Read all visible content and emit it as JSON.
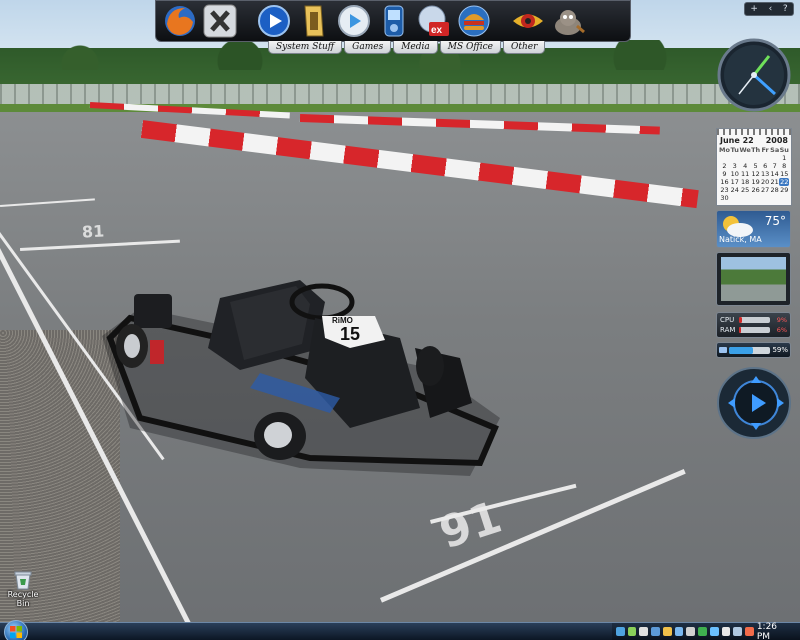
{
  "desktop": {
    "wallpaper_numbers": [
      "81",
      "91"
    ],
    "kart_number": "15",
    "kart_brand": "RiMO"
  },
  "dock": {
    "icons": [
      {
        "name": "firefox-icon"
      },
      {
        "name": "xion-icon"
      },
      {
        "name": "media-player-icon"
      },
      {
        "name": "winamp-icon"
      },
      {
        "name": "play-icon"
      },
      {
        "name": "mp3-player-icon"
      },
      {
        "name": "excel-icon"
      },
      {
        "name": "burger-icon"
      },
      {
        "name": "eye-icon"
      },
      {
        "name": "gimp-icon"
      }
    ],
    "tabs": [
      "System Stuff",
      "Games",
      "Media",
      "MS Office",
      "Other"
    ]
  },
  "sidebar": {
    "controls": [
      "+",
      "‹",
      "?"
    ],
    "calendar": {
      "month_day": "June 22",
      "year": "2008",
      "weekdays": [
        "Mo",
        "Tu",
        "We",
        "Th",
        "Fr",
        "Sa",
        "Su"
      ],
      "days": [
        "",
        "",
        "",
        "",
        "",
        "",
        "1",
        "2",
        "3",
        "4",
        "5",
        "6",
        "7",
        "8",
        "9",
        "10",
        "11",
        "12",
        "13",
        "14",
        "15",
        "16",
        "17",
        "18",
        "19",
        "20",
        "21",
        "22",
        "23",
        "24",
        "25",
        "26",
        "27",
        "28",
        "29",
        "30"
      ],
      "today": "22"
    },
    "weather": {
      "temp": "75°",
      "location": "Natick, MA"
    },
    "cpu": {
      "cpu_label": "CPU",
      "ram_label": "RAM",
      "cpu_value": "9%",
      "ram_value": "6%",
      "cpu_level": 0.09,
      "ram_level": 0.06
    },
    "battery": {
      "value": "59%",
      "level": 0.59
    }
  },
  "desktop_icons": {
    "recycle_bin": "Recycle Bin"
  },
  "taskbar": {
    "time": "1:26 PM",
    "tray_colors": [
      "#4fa3e0",
      "#8ad05a",
      "#e0e0e0",
      "#5c9ad8",
      "#f0c04a",
      "#7ab8f0",
      "#d0d0d0",
      "#3fb04f",
      "#6ac0ff",
      "#e8e8e8",
      "#b0c8e0",
      "#f26b4a"
    ]
  }
}
